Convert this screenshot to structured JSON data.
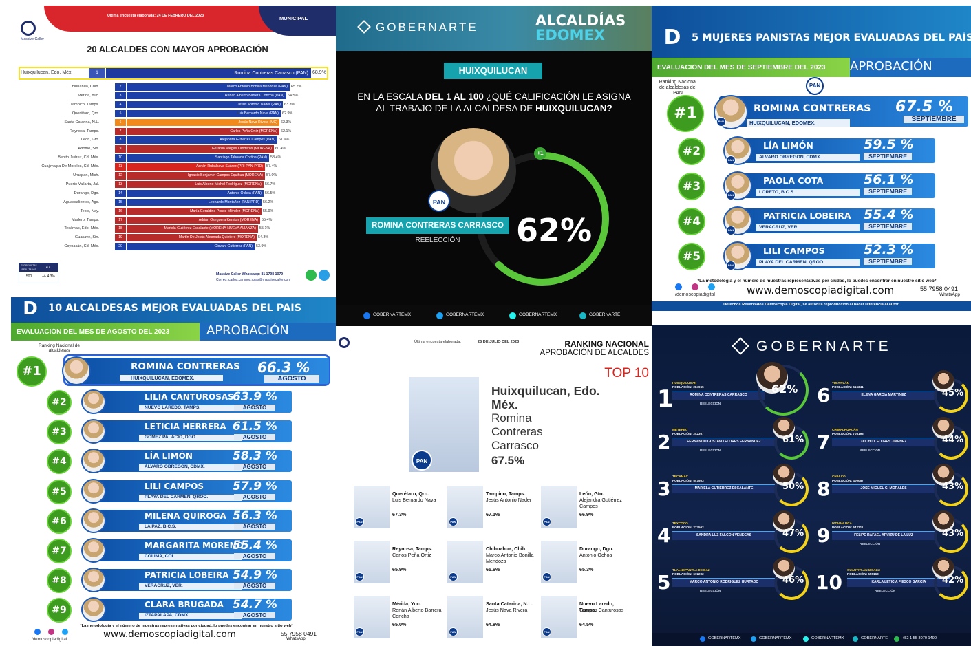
{
  "p1": {
    "updated": "Última encuesta elaborada: 24 DE FEBRERO DEL 2023",
    "tag": "MUNICIPAL",
    "logo": "Massive Caller",
    "title": "20 ALCALDES CON MAYOR APROBACIÓN",
    "top": {
      "city": "Huixquilucan, Edo. Méx.",
      "num": "1",
      "name": "Romina Contreras Carrasco (PAN)",
      "pct": "68.9%"
    },
    "rows": [
      {
        "city": "Chihuahua, Chih.",
        "num": "2",
        "name": "Marco Antonio Bonilla Mendoza (PAN)",
        "pct": "65.7%",
        "color": "#1c3fa8",
        "w": 93
      },
      {
        "city": "Mérida, Yuc.",
        "num": "3",
        "name": "Renán Alberto Barrera Concha (PAN)",
        "pct": "64.5%",
        "color": "#1c3fa8",
        "w": 91
      },
      {
        "city": "Tampico, Tamps.",
        "num": "4",
        "name": "Jesús Antonio Nader (PAN)",
        "pct": "63.3%",
        "color": "#1c3fa8",
        "w": 89
      },
      {
        "city": "Querétaro, Qro.",
        "num": "5",
        "name": "Luis Bernardo Nava (PAN)",
        "pct": "62.9%",
        "color": "#1c3fa8",
        "w": 88
      },
      {
        "city": "Santa Catarina, N.L.",
        "num": "6",
        "name": "Jesús Nava Rivera (MC)",
        "pct": "62.3%",
        "color": "#f08a1c",
        "w": 87
      },
      {
        "city": "Reynosa, Tamps.",
        "num": "7",
        "name": "Carlos Peña Ortiz (MORENA)",
        "pct": "62.1%",
        "color": "#b72b2b",
        "w": 87
      },
      {
        "city": "León, Gto.",
        "num": "8",
        "name": "Alejandra Gutiérrez Campos (PAN)",
        "pct": "61.9%",
        "color": "#1c3fa8",
        "w": 86
      },
      {
        "city": "Ahome, Sin.",
        "num": "9",
        "name": "Gerardo Vargas Landeros (MORENA)",
        "pct": "60.4%",
        "color": "#b72b2b",
        "w": 84
      },
      {
        "city": "Benito Juárez, Cd. Méx.",
        "num": "10",
        "name": "Santiago Taboada Cortina (PAN)",
        "pct": "58.4%",
        "color": "#1c3fa8",
        "w": 81
      },
      {
        "city": "Cuajimalpa De Morelos, Cd. Méx.",
        "num": "11",
        "name": "Adrián Rubalcava Suárez (PRI-PAN-PRD)",
        "pct": "57.4%",
        "color": "#d8261f",
        "w": 79
      },
      {
        "city": "Uruapan, Mich.",
        "num": "12",
        "name": "Ignacio Benjamín Campos Equihua (MORENA)",
        "pct": "57.0%",
        "color": "#b72b2b",
        "w": 79
      },
      {
        "city": "Puerto Vallarta, Jal.",
        "num": "13",
        "name": "Luis Alberto Michel Rodríguez (MORENA)",
        "pct": "56.7%",
        "color": "#b72b2b",
        "w": 78
      },
      {
        "city": "Durango, Dgo.",
        "num": "14",
        "name": "Antonio Ochoa (PAN)",
        "pct": "56.5%",
        "color": "#1c3fa8",
        "w": 78
      },
      {
        "city": "Aguascalientes, Ags.",
        "num": "15",
        "name": "Leonardo Montañez (PAN-PRD)",
        "pct": "56.2%",
        "color": "#1c3fa8",
        "w": 77
      },
      {
        "city": "Tepic, Nay.",
        "num": "16",
        "name": "María Geraldine Ponce Méndez (MORENA)",
        "pct": "55.9%",
        "color": "#b72b2b",
        "w": 77
      },
      {
        "city": "Madero, Tamps.",
        "num": "17",
        "name": "Adrián Oseguera Kernion (MORENA)",
        "pct": "55.4%",
        "color": "#b72b2b",
        "w": 76
      },
      {
        "city": "Tecámac, Edo. Méx.",
        "num": "18",
        "name": "Mariela Gutiérrez Escalante (MORENA-NUEVA ALIANZA)",
        "pct": "55.1%",
        "color": "#b72b2b",
        "w": 75
      },
      {
        "city": "Guasave, Sin.",
        "num": "19",
        "name": "Martín De Jesús Ahumada Quintero (MORENA)",
        "pct": "54.3%",
        "color": "#b72b2b",
        "w": 74
      },
      {
        "city": "Coyoacán, Cd. Méx.",
        "num": "20",
        "name": "Giovani Gutiérrez (PAN)",
        "pct": "53.9%",
        "color": "#1c3fa8",
        "w": 73
      }
    ],
    "table": {
      "h1": "ENTREVISTAS REALIZADAS",
      "h2": "M.E.",
      "v1": "500",
      "v2": "+/- 4.3%"
    },
    "contact1": "Massive Caller Whatsapp: 81 1798 1079",
    "contact2": "Correo: carlos.campos.rojas@massivecaller.com"
  },
  "p2": {
    "brand": "GOBERNARTE",
    "title1": "ALCALDÍAS",
    "title2": "EDOMEX",
    "muni": "HUIXQUILUCAN",
    "question_a": "EN LA ESCALA",
    "question_b": "DEL 1 AL 100",
    "question_c": "¿QUÉ CALIFICACIÓN LE ASIGNA",
    "question_d": "AL TRABAJO DE LA ALCALDESA DE",
    "question_e": "HUIXQUILUCAN?",
    "badge": "+1",
    "party": "PAN",
    "name": "ROMINA CONTRERAS CARRASCO",
    "reelection": "REELECCIÓN",
    "pct": "62%",
    "gauge": 0.62,
    "social": [
      "GOBERNARTEMX",
      "GOBERNARTEMX",
      "GOBERNARTEMX",
      "GOBERNARTE"
    ]
  },
  "p3": {
    "title": "5 MUJERES PANISTAS MEJOR EVALUADAS DEL PAÍS",
    "month_label": "EVALUACIÓN DEL MES DE SEPTIEMBRE DEL 2023",
    "approval": "APROBACIÓN",
    "ranking": "Ranking Nacional de alcaldesas del PAN",
    "party": "PAN",
    "rows": [
      {
        "rank": "#1",
        "name": "ROMINA CONTRERAS",
        "place": "HUIXQUILUCAN, EDOMEX.",
        "pct": "67.5 %",
        "month": "SEPTIEMBRE"
      },
      {
        "rank": "#2",
        "name": "LÍA LIMÓN",
        "place": "ALVARO OBREGÓN, CDMX.",
        "pct": "59.5 %",
        "month": "SEPTIEMBRE"
      },
      {
        "rank": "#3",
        "name": "PAOLA COTA",
        "place": "LORETO, B.C.S.",
        "pct": "56.1 %",
        "month": "SEPTIEMBRE"
      },
      {
        "rank": "#4",
        "name": "PATRICIA LOBEIRA",
        "place": "VERACRUZ, VER.",
        "pct": "55.4 %",
        "month": "SEPTIEMBRE"
      },
      {
        "rank": "#5",
        "name": "LILI CAMPOS",
        "place": "PLAYA DEL CARMEN, QROO.",
        "pct": "52.3 %",
        "month": "SEPTIEMBRE"
      }
    ],
    "brand": "DEMOSCOPIA DIGITAL",
    "note": "*La metodología y el número de muestras representativas por ciudad, lo puedes encontrar en nuestro sitio web*",
    "url": "www.demoscopiadigital.com",
    "handle": "/demoscopiadigital",
    "phone": "55 7958 0491",
    "wa": "WhatsApp",
    "rights": "Derechos Reservados Demoscopia Digital, se autoriza reproducción al hacer referencia al autor."
  },
  "p4": {
    "title": "10 ALCALDESAS MEJOR EVALUADAS DEL PAÍS",
    "month_label": "EVALUACIÓN DEL MES DE AGOSTO DEL 2023",
    "approval": "APROBACIÓN",
    "ranking": "Ranking Nacional de alcaldesas",
    "brand": "DEMOSCOPIA DIGITAL",
    "rows": [
      {
        "rank": "#1",
        "name": "ROMINA CONTRERAS",
        "place": "HUIXQUILUCAN, EDOMEX.",
        "pct": "66.3 %",
        "month": "AGOSTO"
      },
      {
        "rank": "#2",
        "name": "LILIA CANTUROSAS",
        "place": "NUEVO LAREDO, TAMPS.",
        "pct": "63.9 %",
        "month": "AGOSTO"
      },
      {
        "rank": "#3",
        "name": "LETICIA HERRERA",
        "place": "GÓMEZ PALACIO, DGO.",
        "pct": "61.5 %",
        "month": "AGOSTO"
      },
      {
        "rank": "#4",
        "name": "LÍA LIMÓN",
        "place": "ÁLVARO OBREGÓN, CDMX.",
        "pct": "58.3 %",
        "month": "AGOSTO"
      },
      {
        "rank": "#5",
        "name": "LILI CAMPOS",
        "place": "PLAYA DEL CARMEN, QROO.",
        "pct": "57.9 %",
        "month": "AGOSTO"
      },
      {
        "rank": "#6",
        "name": "MILENA QUIROGA",
        "place": "LA PAZ, B.C.S.",
        "pct": "56.3 %",
        "month": "AGOSTO"
      },
      {
        "rank": "#7",
        "name": "MARGARITA MORENO",
        "place": "COLIMA, COL.",
        "pct": "55.4 %",
        "month": "AGOSTO"
      },
      {
        "rank": "#8",
        "name": "PATRICIA LOBEIRA",
        "place": "VERACRUZ, VER.",
        "pct": "54.9 %",
        "month": "AGOSTO"
      },
      {
        "rank": "#9",
        "name": "CLARA BRUGADA",
        "place": "IZTAPALAPA, CDMX.",
        "pct": "54.7 %",
        "month": "AGOSTO"
      }
    ],
    "note": "*La metodología y el número de muestras representativas por ciudad, lo puedes encontrar en nuestro sitio web*",
    "url": "www.demoscopiadigital.com",
    "handle": "/demoscopiadigital",
    "phone": "55 7958 0491",
    "wa": "WhatsApp"
  },
  "p5": {
    "updated_label": "Última encuesta elaborada:",
    "updated_date": "25 DE JULIO DEL 2023",
    "title1": "RANKING NACIONAL",
    "title2": "APROBACIÓN DE ALCALDES",
    "top10": "TOP 10",
    "main_city": "Huixquilucan, Edo. Méx.",
    "main_name": "Romina Contreras Carrasco",
    "main_pct": "67.5%",
    "party": "PAN",
    "items": [
      {
        "city": "Querétaro, Qro.",
        "name": "Luis Bernardo Nava",
        "pct": "67.3%"
      },
      {
        "city": "Tampico, Tamps.",
        "name": "Jesús Antonio Nader",
        "pct": "67.1%"
      },
      {
        "city": "León, Gto.",
        "name": "Alejandra Gutiérrez Campos",
        "pct": "66.9%"
      },
      {
        "city": "Reynosa, Tamps.",
        "name": "Carlos Peña Ortiz",
        "pct": "65.9%"
      },
      {
        "city": "Chihuahua, Chih.",
        "name": "Marco Antonio Bonilla Mendoza",
        "pct": "65.6%"
      },
      {
        "city": "Durango, Dgo.",
        "name": "Antonio Ochoa",
        "pct": "65.3%"
      },
      {
        "city": "Mérida, Yuc.",
        "name": "Renán Alberto Barrera Concha",
        "pct": "65.0%"
      },
      {
        "city": "Santa Catarina, N.L.",
        "name": "Jesús Nava Rivera",
        "pct": "64.8%"
      },
      {
        "city": "Nuevo Laredo, Tamps.",
        "name": "Carmen Canturosas",
        "pct": "64.5%"
      }
    ]
  },
  "p6": {
    "brand": "GOBERNARTE",
    "left": [
      {
        "n": "1",
        "city": "HUIXQUILUCAN",
        "pop": "POBLACIÓN: 284965",
        "name": "ROMINA CONTRERAS CARRASCO",
        "tag": "REELECCIÓN",
        "pct": "62%",
        "ring": "#5ac73a"
      },
      {
        "n": "2",
        "city": "METEPEC",
        "pop": "POBLACIÓN: 242307",
        "name": "FERNANDO GUSTAVO FLORES FERNÁNDEZ",
        "tag": "REELECCIÓN",
        "pct": "61%",
        "ring": "#5ac73a"
      },
      {
        "n": "3",
        "city": "TECÁMAC",
        "pop": "POBLACIÓN: 547503",
        "name": "MARIELA GUTIÉRREZ ESCALANTE",
        "tag": "",
        "pct": "50%",
        "ring": "#f2d21b"
      },
      {
        "n": "4",
        "city": "TEXCOCO",
        "pop": "POBLACIÓN: 277562",
        "name": "SANDRA LUZ FALCÓN VENEGAS",
        "tag": "",
        "pct": "47%",
        "ring": "#f2d21b"
      },
      {
        "n": "5",
        "city": "TLALNEPANTLA DE BAZ",
        "pop": "POBLACIÓN: 672202",
        "name": "MARCO ANTONIO RODRÍGUEZ HURTADO",
        "tag": "REELECCIÓN",
        "pct": "46%",
        "ring": "#f2d21b"
      }
    ],
    "right": [
      {
        "n": "6",
        "city": "TULTITLÁN",
        "pop": "POBLACIÓN: 516341",
        "name": "ELENA GARCÍA MARTÍNEZ",
        "tag": "",
        "pct": "45%",
        "ring": "#f2d21b"
      },
      {
        "n": "7",
        "city": "CHIMALHUACÁN",
        "pop": "POBLACIÓN: 705193",
        "name": "XÓCHITL FLORES JIMÉNEZ",
        "tag": "REELECCIÓN",
        "pct": "44%",
        "ring": "#f2d21b"
      },
      {
        "n": "8",
        "city": "CHALCO",
        "pop": "POBLACIÓN: 400057",
        "name": "JOSÉ MIGUEL G. MORALES",
        "tag": "",
        "pct": "43%",
        "ring": "#f2d21b"
      },
      {
        "n": "9",
        "city": "IXTAPALUCA",
        "pop": "POBLACIÓN: 542211",
        "name": "FELIPE RAFAEL ARVIZU DE LA LUZ",
        "tag": "REELECCIÓN",
        "pct": "43%",
        "ring": "#f2d21b"
      },
      {
        "n": "10",
        "city": "CUAUTITLÁN IZCALLI",
        "pop": "POBLACIÓN: 555163",
        "name": "KARLA LETICIA FIESCO GARCÍA",
        "tag": "REELECCIÓN",
        "pct": "42%",
        "ring": "#f2d21b"
      }
    ],
    "social": [
      "GOBERNARTEMX",
      "GOBERNARTEMX",
      "GOBERNARTEMX",
      "GOBERNARTE",
      "+52 1 55 3070 1490"
    ]
  }
}
